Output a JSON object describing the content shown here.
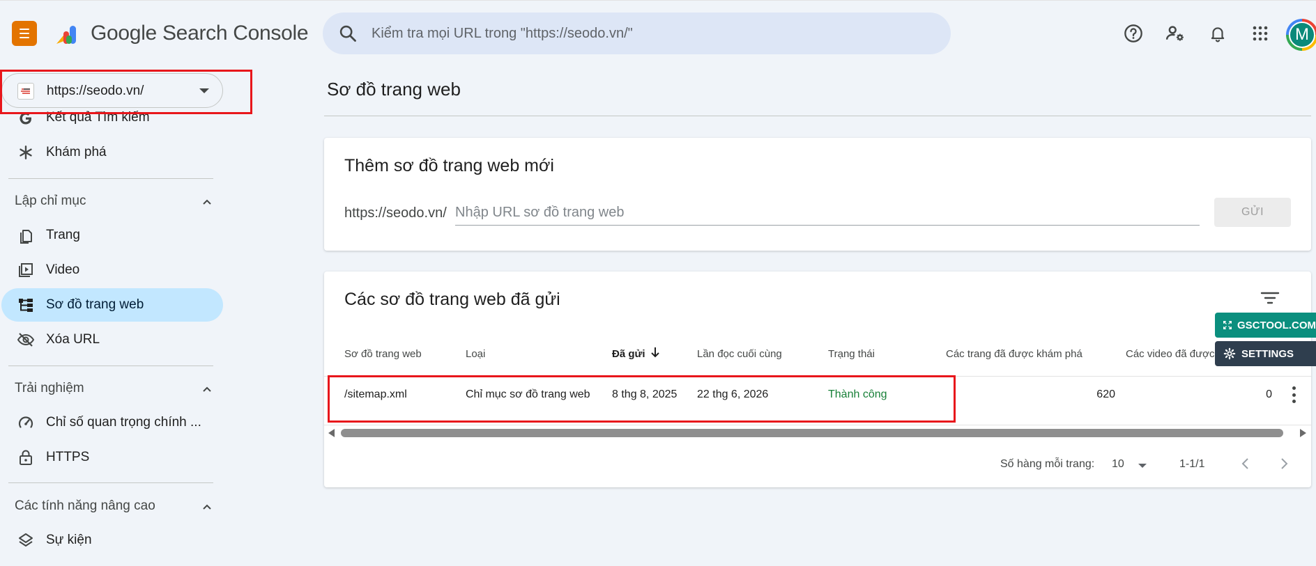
{
  "header": {
    "brand": "Google Search Console",
    "search_placeholder": "Kiểm tra mọi URL trong \"https://seodo.vn/\"",
    "avatar_letter": "M"
  },
  "sidebar": {
    "property": "https://seodo.vn/",
    "partial_item": "Kết quả Tìm kiếm",
    "explore": "Khám phá",
    "sections": [
      {
        "title": "Lập chỉ mục",
        "items": [
          "Trang",
          "Video",
          "Sơ đồ trang web",
          "Xóa URL"
        ]
      },
      {
        "title": "Trải nghiệm",
        "items": [
          "Chỉ số quan trọng chính ...",
          "HTTPS"
        ]
      },
      {
        "title": "Các tính năng nâng cao",
        "items": [
          "Sự kiện"
        ]
      }
    ]
  },
  "main": {
    "page_title": "Sơ đồ trang web",
    "add_card": {
      "title": "Thêm sơ đồ trang web mới",
      "prefix": "https://seodo.vn/",
      "placeholder": "Nhập URL sơ đồ trang web",
      "submit": "GỬI"
    },
    "submitted_card": {
      "title": "Các sơ đồ trang web đã gửi",
      "columns": [
        "Sơ đồ trang web",
        "Loại",
        "Đã gửi",
        "Lần đọc cuối cùng",
        "Trạng thái",
        "Các trang đã được khám phá",
        "Các video đã được"
      ],
      "rows": [
        {
          "sitemap": "/sitemap.xml",
          "type": "Chỉ mục sơ đồ trang web",
          "submitted": "8 thg 8, 2025",
          "last_read": "22 thg 6, 2026",
          "status": "Thành công",
          "pages": "620",
          "videos": "0"
        }
      ],
      "pager": {
        "rows_label": "Số hàng mỗi trang:",
        "rows_value": "10",
        "range": "1-1/1"
      }
    }
  },
  "extension": {
    "gsctool": "GSCTOOL.COM",
    "settings": "SETTINGS"
  },
  "colors": {
    "accent": "#c2e7ff",
    "success": "#188038",
    "highlight": "#e8161b",
    "menu": "#e37400"
  }
}
